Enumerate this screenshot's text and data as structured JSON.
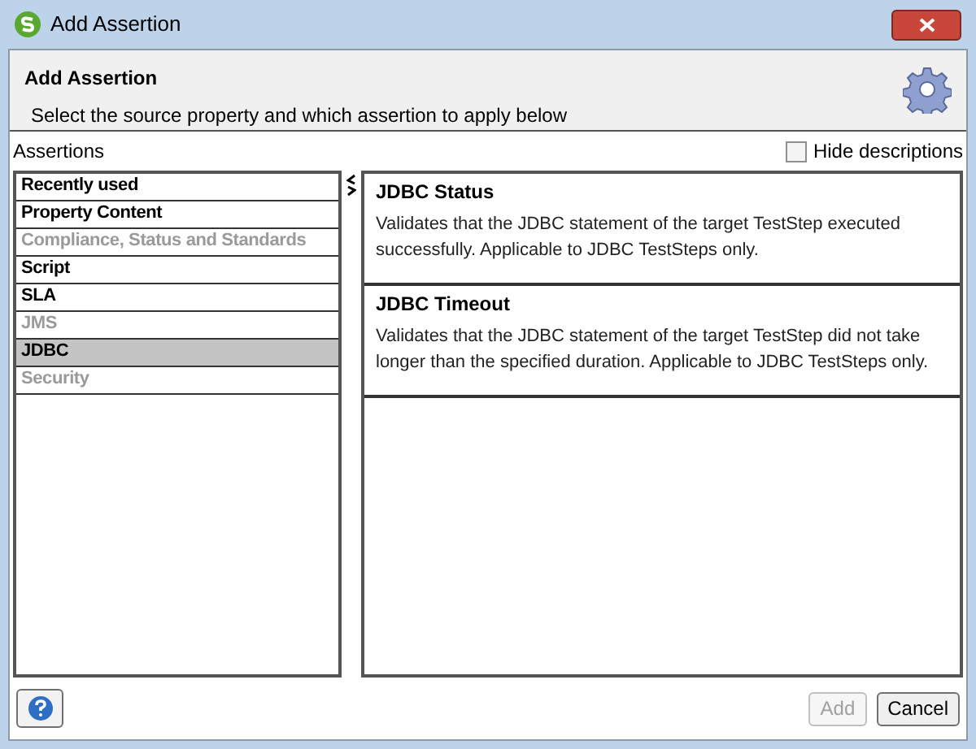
{
  "window": {
    "title": "Add Assertion"
  },
  "header": {
    "title": "Add Assertion",
    "subtitle": "Select the source property and which assertion to apply below"
  },
  "assertions_label": "Assertions",
  "hide_descriptions": {
    "label": "Hide descriptions",
    "checked": false
  },
  "categories": [
    {
      "label": "Recently used",
      "disabled": false,
      "selected": false
    },
    {
      "label": "Property Content",
      "disabled": false,
      "selected": false
    },
    {
      "label": "Compliance, Status and Standards",
      "disabled": true,
      "selected": false
    },
    {
      "label": "Script",
      "disabled": false,
      "selected": false
    },
    {
      "label": "SLA",
      "disabled": false,
      "selected": false
    },
    {
      "label": "JMS",
      "disabled": true,
      "selected": false
    },
    {
      "label": "JDBC",
      "disabled": false,
      "selected": true
    },
    {
      "label": "Security",
      "disabled": true,
      "selected": false
    }
  ],
  "assertions": [
    {
      "name": "JDBC Status",
      "description": "Validates that the JDBC statement of the target TestStep executed successfully. Applicable to JDBC TestSteps only."
    },
    {
      "name": "JDBC Timeout",
      "description": "Validates that the JDBC statement of the target TestStep did not take longer than the specified duration. Applicable to JDBC TestSteps only."
    }
  ],
  "buttons": [
    {
      "label": "Add",
      "disabled": true
    },
    {
      "label": "Cancel",
      "disabled": false
    }
  ]
}
